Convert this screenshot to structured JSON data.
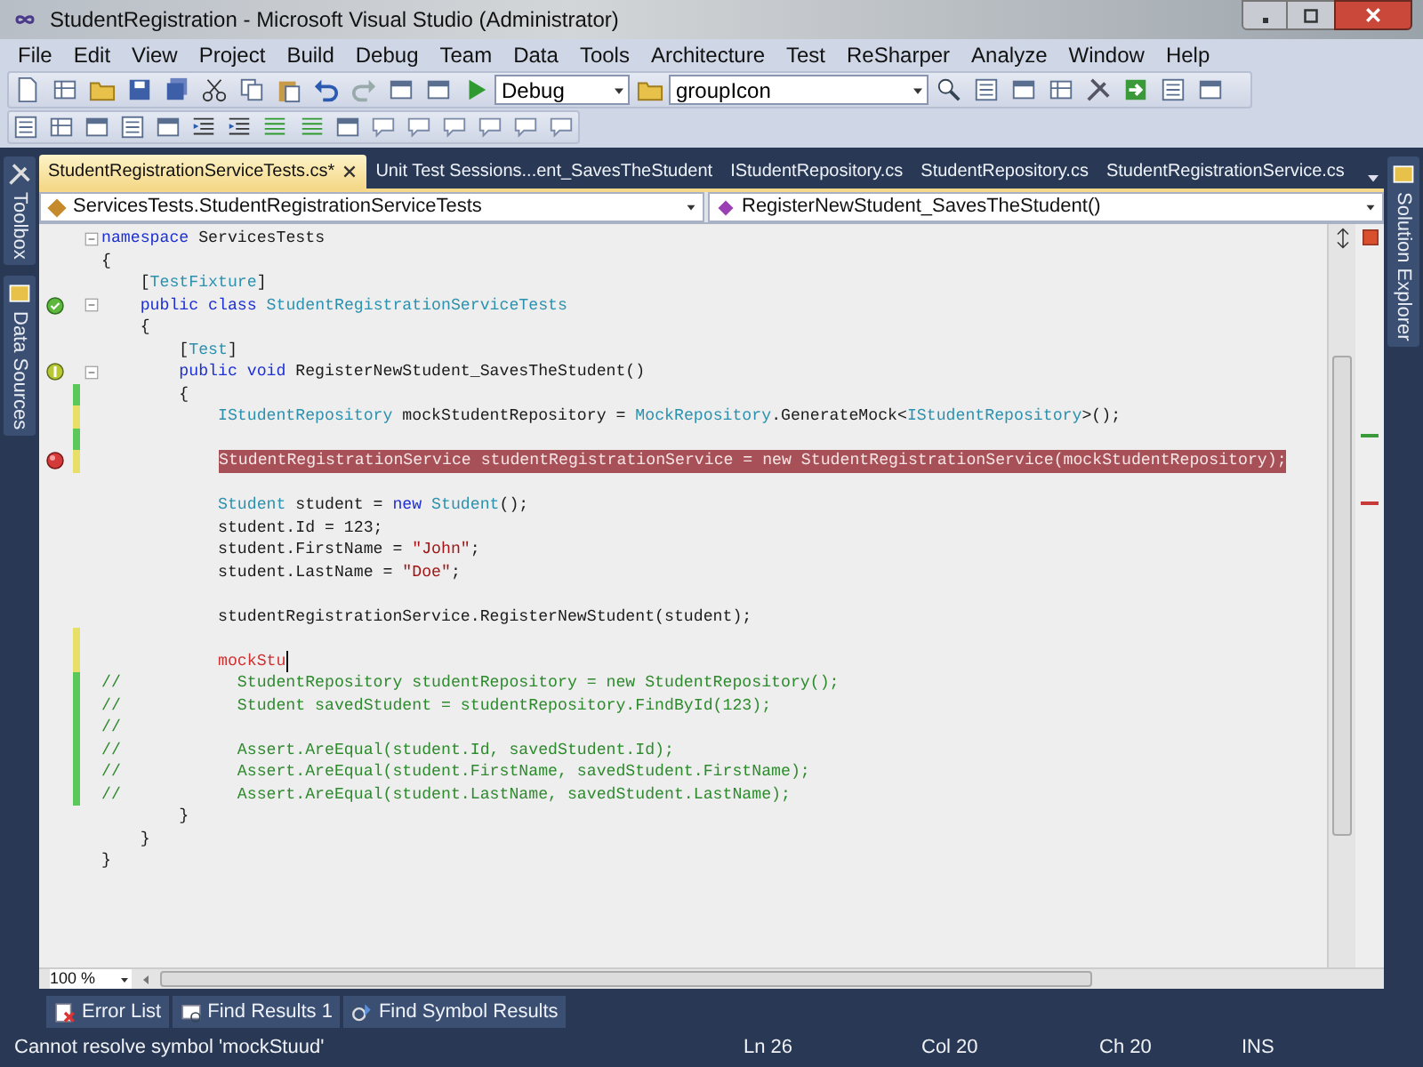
{
  "window": {
    "title": "StudentRegistration - Microsoft Visual Studio (Administrator)"
  },
  "menu": [
    "File",
    "Edit",
    "View",
    "Project",
    "Build",
    "Debug",
    "Team",
    "Data",
    "Tools",
    "Architecture",
    "Test",
    "ReSharper",
    "Analyze",
    "Window",
    "Help"
  ],
  "toolbar": {
    "configuration": "Debug",
    "find_combo": "groupIcon"
  },
  "side_tabs_left": [
    "Toolbox",
    "Data Sources"
  ],
  "side_tabs_right": [
    "Solution Explorer"
  ],
  "tabs": [
    {
      "label": "StudentRegistrationServiceTests.cs*",
      "selected": true
    },
    {
      "label": "Unit Test Sessions...ent_SavesTheStudent",
      "selected": false
    },
    {
      "label": "IStudentRepository.cs",
      "selected": false
    },
    {
      "label": "StudentRepository.cs",
      "selected": false
    },
    {
      "label": "StudentRegistrationService.cs",
      "selected": false
    }
  ],
  "navigation": {
    "type_combo": "ServicesTests.StudentRegistrationServiceTests",
    "member_combo": "RegisterNewStudent_SavesTheStudent()"
  },
  "code_lines": [
    {
      "collapsible": true,
      "tokens": [
        {
          "kind": "keyword",
          "text": "namespace"
        },
        {
          "kind": "plain",
          "text": " ServicesTests"
        }
      ]
    },
    {
      "tokens": [
        {
          "kind": "plain",
          "text": "{"
        }
      ]
    },
    {
      "tokens": [
        {
          "kind": "plain",
          "text": "    ["
        },
        {
          "kind": "type",
          "text": "TestFixture"
        },
        {
          "kind": "plain",
          "text": "]"
        }
      ]
    },
    {
      "test_passed": true,
      "collapsible": true,
      "tokens": [
        {
          "kind": "keyword",
          "text": "    public class"
        },
        {
          "kind": "type",
          "text": " StudentRegistrationServiceTests"
        }
      ]
    },
    {
      "tokens": [
        {
          "kind": "plain",
          "text": "    {"
        }
      ]
    },
    {
      "tokens": [
        {
          "kind": "plain",
          "text": "        ["
        },
        {
          "kind": "type",
          "text": "Test"
        },
        {
          "kind": "plain",
          "text": "]"
        }
      ]
    },
    {
      "test_marker": true,
      "collapsible": true,
      "tokens": [
        {
          "kind": "keyword",
          "text": "        public void"
        },
        {
          "kind": "plain",
          "text": " RegisterNewStudent_SavesTheStudent()"
        }
      ]
    },
    {
      "saved_change": true,
      "tokens": [
        {
          "kind": "plain",
          "text": "        {"
        }
      ]
    },
    {
      "unsaved_change": true,
      "tokens": [
        {
          "kind": "type",
          "text": "            IStudentRepository"
        },
        {
          "kind": "plain",
          "text": " mockStudentRepository = "
        },
        {
          "kind": "type",
          "text": "MockRepository"
        },
        {
          "kind": "plain",
          "text": ".GenerateMock<"
        },
        {
          "kind": "type",
          "text": "IStudentRepository"
        },
        {
          "kind": "plain",
          "text": ">();"
        }
      ]
    },
    {
      "saved_change": true
    },
    {
      "breakpoint": true,
      "unsaved_change": true,
      "highlighted": true,
      "tokens": [
        {
          "kind": "plain",
          "text": "StudentRegistrationService studentRegistrationService = new StudentRegistrationService(mockStudentRepository);"
        }
      ]
    },
    {
      "kind": "blank"
    },
    {
      "tokens": [
        {
          "kind": "type",
          "text": "            Student"
        },
        {
          "kind": "plain",
          "text": " student = "
        },
        {
          "kind": "keyword",
          "text": "new"
        },
        {
          "kind": "type",
          "text": " Student"
        },
        {
          "kind": "plain",
          "text": "();"
        }
      ]
    },
    {
      "tokens": [
        {
          "kind": "plain",
          "text": "            student.Id = 123;"
        }
      ]
    },
    {
      "tokens": [
        {
          "kind": "plain",
          "text": "            student.FirstName = "
        },
        {
          "kind": "string",
          "text": "\"John\""
        },
        {
          "kind": "plain",
          "text": ";"
        }
      ]
    },
    {
      "tokens": [
        {
          "kind": "plain",
          "text": "            student.LastName = "
        },
        {
          "kind": "string",
          "text": "\"Doe\""
        },
        {
          "kind": "plain",
          "text": ";"
        }
      ]
    },
    {
      "kind": "blank"
    },
    {
      "tokens": [
        {
          "kind": "plain",
          "text": "            studentRegistrationService.RegisterNewStudent(student);"
        }
      ]
    },
    {
      "unsaved_change": true
    },
    {
      "unsaved_change": true,
      "tokens": [
        {
          "kind": "error",
          "text": "            mockStu"
        }
      ]
    },
    {
      "saved_change": true,
      "tokens": [
        {
          "kind": "comment",
          "text": "//            StudentRepository studentRepository = new StudentRepository();"
        }
      ]
    },
    {
      "saved_change": true,
      "tokens": [
        {
          "kind": "comment",
          "text": "//            Student savedStudent = studentRepository.FindById(123);"
        }
      ]
    },
    {
      "saved_change": true,
      "tokens": [
        {
          "kind": "comment",
          "text": "//"
        }
      ]
    },
    {
      "saved_change": true,
      "tokens": [
        {
          "kind": "comment",
          "text": "//            Assert.AreEqual(student.Id, savedStudent.Id);"
        }
      ]
    },
    {
      "saved_change": true,
      "tokens": [
        {
          "kind": "comment",
          "text": "//            Assert.AreEqual(student.FirstName, savedStudent.FirstName);"
        }
      ]
    },
    {
      "saved_change": true,
      "tokens": [
        {
          "kind": "comment",
          "text": "//            Assert.AreEqual(student.LastName, savedStudent.LastName);"
        }
      ]
    },
    {
      "tokens": [
        {
          "kind": "plain",
          "text": "        }"
        }
      ]
    },
    {
      "tokens": [
        {
          "kind": "plain",
          "text": "    }"
        }
      ]
    },
    {
      "tokens": [
        {
          "kind": "plain",
          "text": "}"
        }
      ]
    }
  ],
  "zoom": "100 %",
  "tool_tabs": [
    "Error List",
    "Find Results 1",
    "Find Symbol Results"
  ],
  "status_bar": {
    "message": "Cannot resolve symbol 'mockStuud'",
    "line": "Ln 26",
    "column": "Col 20",
    "char": "Ch 20",
    "mode": "INS"
  }
}
